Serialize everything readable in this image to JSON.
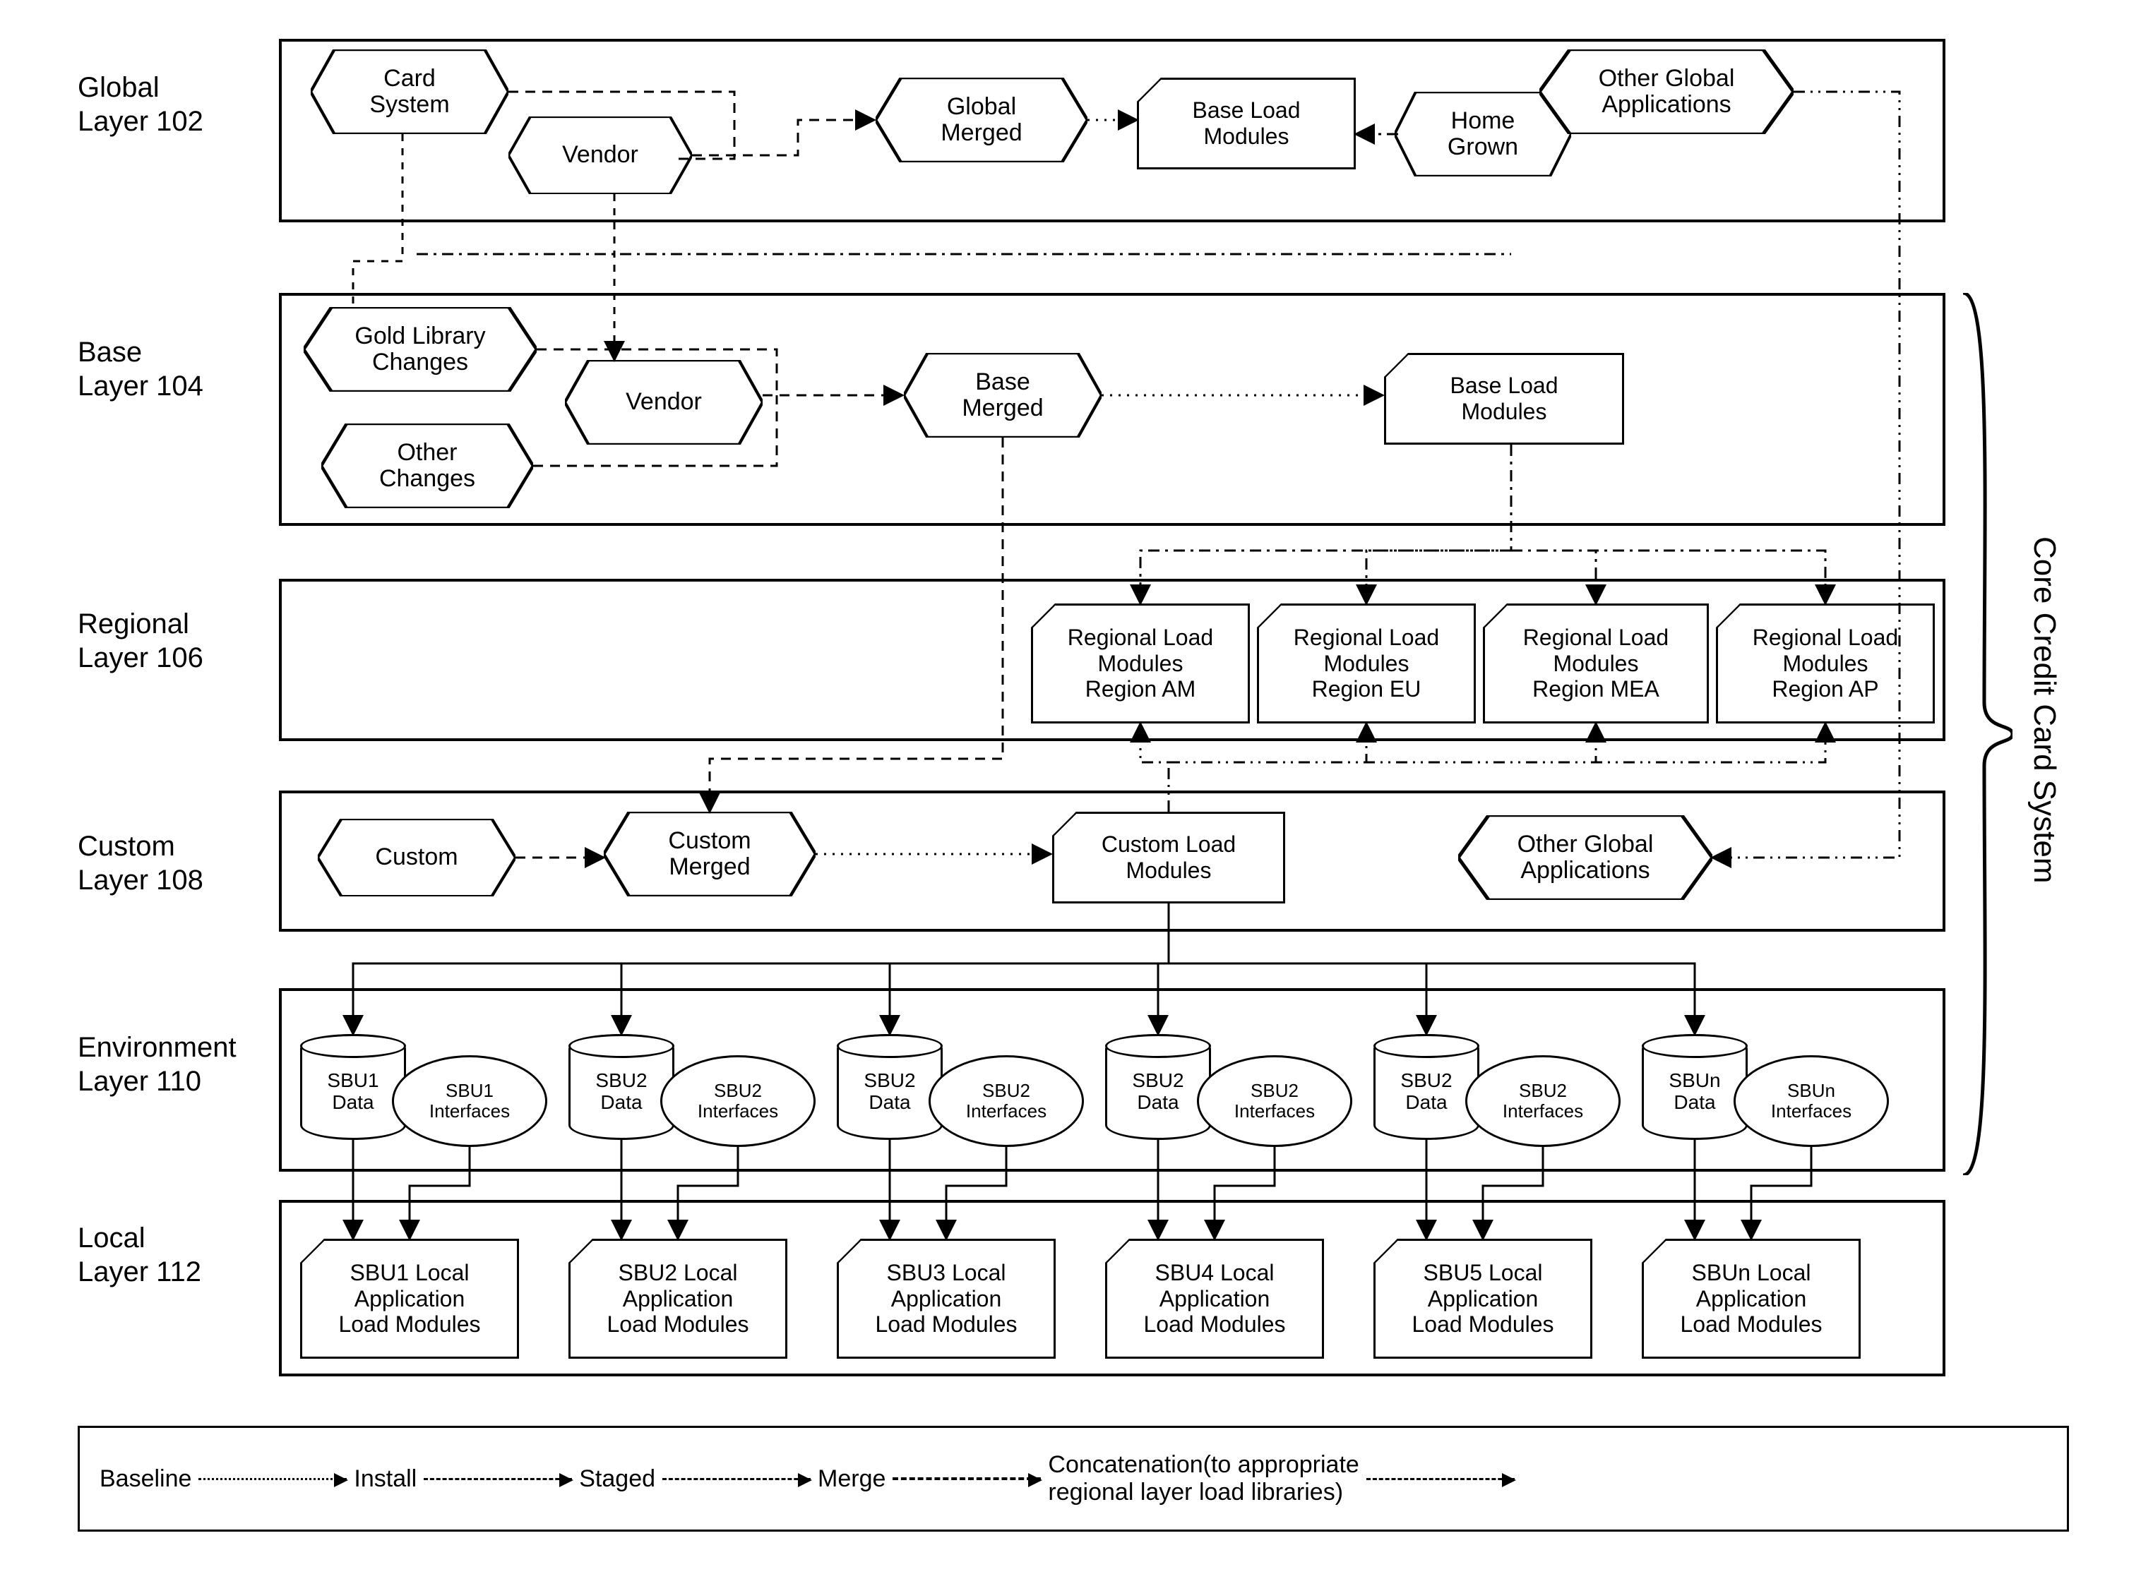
{
  "title": "Core Credit Card System",
  "layers": {
    "global": {
      "label": "Global\nLayer 102"
    },
    "base": {
      "label": "Base\nLayer 104"
    },
    "regional": {
      "label": "Regional\nLayer 106"
    },
    "custom": {
      "label": "Custom\nLayer 108"
    },
    "env": {
      "label": "Environment\nLayer 110"
    },
    "local": {
      "label": "Local\nLayer 112"
    }
  },
  "global_nodes": {
    "card_system": "Card\nSystem",
    "vendor": "Vendor",
    "global_merged": "Global\nMerged",
    "base_load_modules": "Base Load\nModules",
    "home_grown": "Home\nGrown",
    "other_global_apps": "Other Global\nApplications"
  },
  "base_nodes": {
    "gold_library_changes": "Gold Library\nChanges",
    "other_changes": "Other\nChanges",
    "vendor": "Vendor",
    "base_merged": "Base\nMerged",
    "base_load_modules": "Base Load\nModules"
  },
  "regional_nodes": [
    {
      "id": "am",
      "label": "Regional Load\nModules\nRegion AM"
    },
    {
      "id": "eu",
      "label": "Regional Load\nModules\nRegion EU"
    },
    {
      "id": "mea",
      "label": "Regional Load\nModules\nRegion MEA"
    },
    {
      "id": "ap",
      "label": "Regional Load\nModules\nRegion AP"
    }
  ],
  "custom_nodes": {
    "custom": "Custom",
    "custom_merged": "Custom\nMerged",
    "custom_load_modules": "Custom Load\nModules",
    "other_global_apps": "Other Global\nApplications"
  },
  "env_units": [
    {
      "data": "SBU1\nData",
      "interfaces": "SBU1\nInterfaces"
    },
    {
      "data": "SBU2\nData",
      "interfaces": "SBU2\nInterfaces"
    },
    {
      "data": "SBU2\nData",
      "interfaces": "SBU2\nInterfaces"
    },
    {
      "data": "SBU2\nData",
      "interfaces": "SBU2\nInterfaces"
    },
    {
      "data": "SBU2\nData",
      "interfaces": "SBU2\nInterfaces"
    },
    {
      "data": "SBUn\nData",
      "interfaces": "SBUn\nInterfaces"
    }
  ],
  "local_modules": [
    "SBU1 Local\nApplication\nLoad Modules",
    "SBU2 Local\nApplication\nLoad Modules",
    "SBU3 Local\nApplication\nLoad Modules",
    "SBU4 Local\nApplication\nLoad Modules",
    "SBU5 Local\nApplication\nLoad Modules",
    "SBUn Local\nApplication\nLoad Modules"
  ],
  "legend": {
    "baseline": "Baseline",
    "install": "Install",
    "staged": "Staged",
    "merge": "Merge",
    "concat": "Concatenation(to appropriate\nregional layer load libraries)"
  }
}
